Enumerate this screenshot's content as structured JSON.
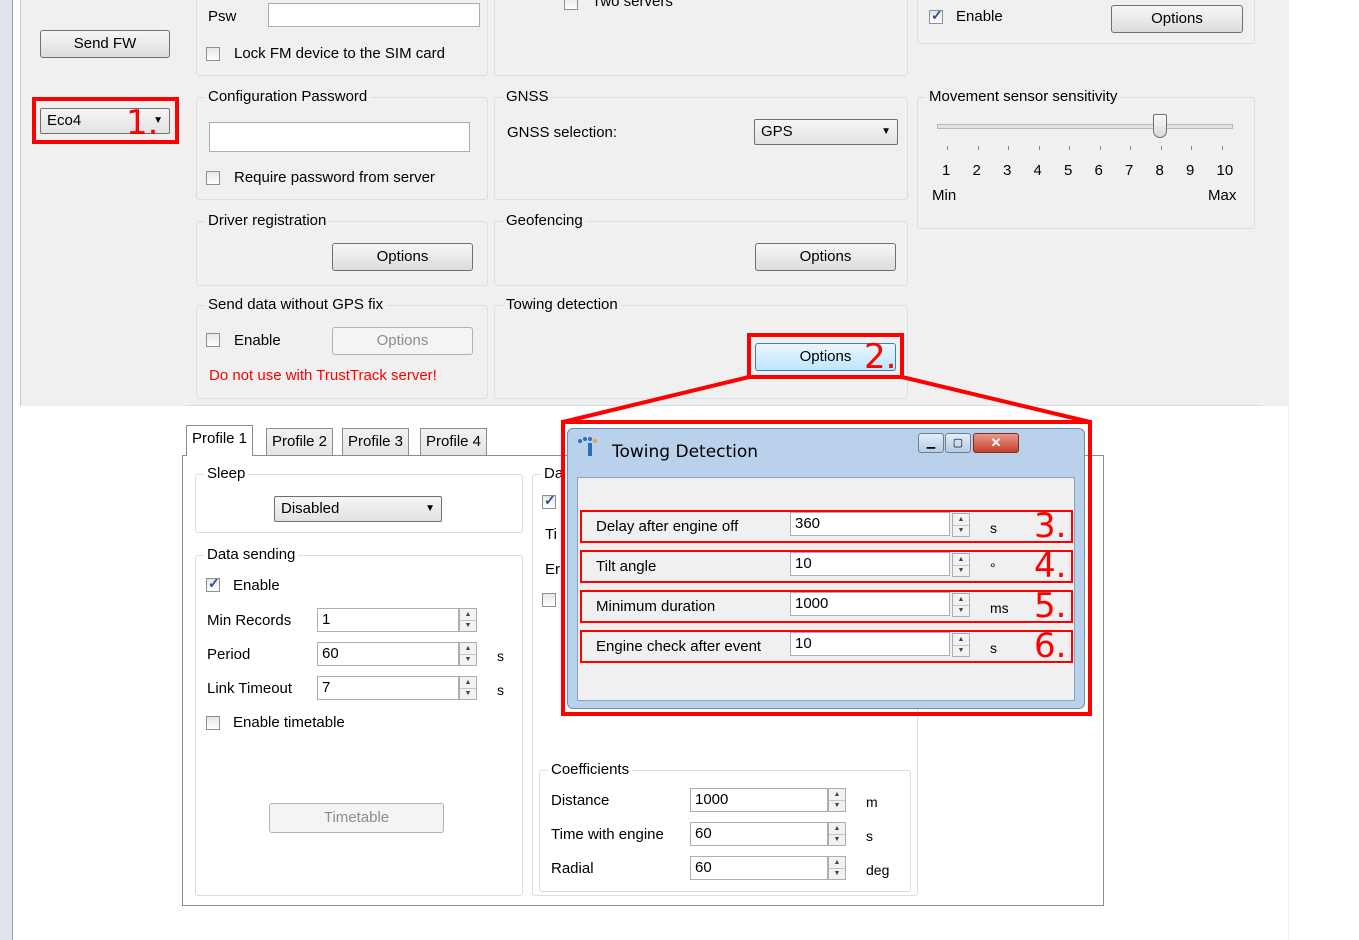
{
  "left_panel": {
    "send_fw_label": "Send FW",
    "device_value": "Eco4"
  },
  "sim_group": {
    "psw_label": "Psw",
    "lock_fm_label": "Lock FM device to the SIM card"
  },
  "server_group": {
    "two_servers_label": "Two servers"
  },
  "top_right_group": {
    "enable_label": "Enable",
    "options_label": "Options"
  },
  "config_password": {
    "title": "Configuration Password",
    "password_value": "",
    "require_label": "Require password from server"
  },
  "gnss": {
    "title": "GNSS",
    "selection_label": "GNSS selection:",
    "selection_value": "GPS"
  },
  "movement_sensor": {
    "title": "Movement sensor sensitivity",
    "ticks": [
      "1",
      "2",
      "3",
      "4",
      "5",
      "6",
      "7",
      "8",
      "9",
      "10"
    ],
    "min_label": "Min",
    "max_label": "Max",
    "value": 8
  },
  "driver_registration": {
    "title": "Driver registration",
    "options_label": "Options"
  },
  "geofencing": {
    "title": "Geofencing",
    "options_label": "Options"
  },
  "send_without_fix": {
    "title": "Send data without GPS fix",
    "enable_label": "Enable",
    "options_label": "Options",
    "warning": "Do not use with TrustTrack server!"
  },
  "towing_group": {
    "title": "Towing detection",
    "options_label": "Options"
  },
  "tabs": [
    {
      "label": "Profile 1"
    },
    {
      "label": "Profile 2"
    },
    {
      "label": "Profile 3"
    },
    {
      "label": "Profile 4"
    }
  ],
  "sleep": {
    "title": "Sleep",
    "value": "Disabled"
  },
  "data_sending": {
    "title": "Data sending",
    "enable_label": "Enable",
    "min_records_label": "Min Records",
    "min_records_value": "1",
    "period_label": "Period",
    "period_value": "60",
    "period_unit": "s",
    "link_timeout_label": "Link Timeout",
    "link_timeout_value": "7",
    "link_timeout_unit": "s",
    "timetable_label": "Enable timetable",
    "timetable_button": "Timetable"
  },
  "partial_group": {
    "title": "Da",
    "row1": "Ti",
    "row2": "Er"
  },
  "coefficients": {
    "title": "Coefficients",
    "rows": [
      {
        "label": "Distance",
        "value": "1000",
        "unit": "m"
      },
      {
        "label": "Time with engine",
        "value": "60",
        "unit": "s"
      },
      {
        "label": "Radial",
        "value": "60",
        "unit": "deg"
      }
    ]
  },
  "dialog": {
    "title": "Towing Detection",
    "rows": [
      {
        "label": "Delay after engine off",
        "value": "360",
        "unit": "s"
      },
      {
        "label": "Tilt angle",
        "value": "10",
        "unit": "°"
      },
      {
        "label": "Minimum duration",
        "value": "1000",
        "unit": "ms"
      },
      {
        "label": "Engine check after event",
        "value": "10",
        "unit": "s"
      }
    ]
  },
  "markers": [
    "1.",
    "2.",
    "3.",
    "4.",
    "5.",
    "6."
  ],
  "colors": {
    "annotation_red": "#ff0000",
    "warning_red": "#ff0000",
    "window_bg": "#f0f0f0"
  }
}
